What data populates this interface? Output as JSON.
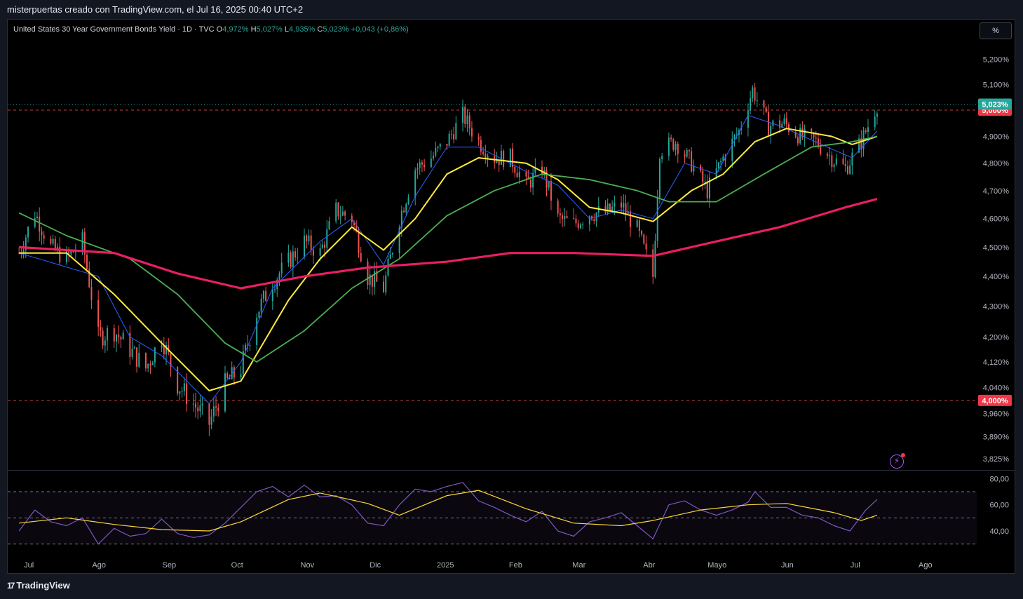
{
  "header": {
    "attribution": "misterpuertas creado con TradingView.com, el Jul 16, 2025 00:40 UTC+2"
  },
  "legend": {
    "symbol": "United States 30 Year Government Bonds Yield · 1D · TVC",
    "o_label": "O",
    "o_value": "4,972%",
    "h_label": "H",
    "h_value": "5,027%",
    "l_label": "L",
    "l_value": "4,935%",
    "c_label": "C",
    "c_value": "5,023%",
    "change": "+0,043 (+0,86%)"
  },
  "unit_button": "%",
  "footer": {
    "brand": "TradingView",
    "logo": "17"
  },
  "colors": {
    "up": "#26a69a",
    "down": "#ef5350",
    "ma_fast": "#2962ff",
    "ma_mid": "#ffeb3b",
    "ma_slow": "#4caf50",
    "ma_long": "#e91e63",
    "rsi": "#7e57c2",
    "rsi_ma": "#fdd835"
  },
  "chart_data": [
    {
      "type": "candlestick",
      "title": "United States 30 Year Government Bonds Yield · 1D · TVC",
      "y_ticks": [
        "5,200%",
        "5,100%",
        "4,900%",
        "4,800%",
        "4,700%",
        "4,600%",
        "4,500%",
        "4,400%",
        "4,300%",
        "4,200%",
        "4,120%",
        "4,040%",
        "3,960%",
        "3,890%",
        "3,825%"
      ],
      "y_scale": "log",
      "ylim": [
        3.8,
        5.26
      ],
      "x_ticks": [
        "Jul",
        "Ago",
        "Sep",
        "Oct",
        "Nov",
        "Dic",
        "2025",
        "Feb",
        "Mar",
        "Abr",
        "Mayo",
        "Jun",
        "Jul",
        "Ago"
      ],
      "last_price_label": "5,023%",
      "horizontal_lines": [
        {
          "value": 5.0,
          "label": "5,000%"
        },
        {
          "value": 4.0,
          "label": "4,000%"
        }
      ],
      "series": [
        {
          "name": "close",
          "x": [
            "Jul",
            "Ago",
            "Sep",
            "Oct",
            "Nov",
            "Dic",
            "2025",
            "Feb",
            "Mar",
            "Abr",
            "Mayo",
            "Jun",
            "Jul"
          ],
          "values": [
            4.47,
            4.42,
            4.1,
            4.06,
            4.58,
            4.4,
            4.94,
            4.78,
            4.64,
            4.55,
            4.85,
            4.92,
            5.02
          ]
        }
      ],
      "anchors": {
        "points": [
          [
            "2024-07-01",
            4.48
          ],
          [
            "2024-07-08",
            4.62
          ],
          [
            "2024-07-15",
            4.5
          ],
          [
            "2024-07-22",
            4.46
          ],
          [
            "2024-07-29",
            4.52
          ],
          [
            "2024-08-05",
            4.2
          ],
          [
            "2024-08-12",
            4.22
          ],
          [
            "2024-08-19",
            4.16
          ],
          [
            "2024-08-26",
            4.1
          ],
          [
            "2024-09-02",
            4.2
          ],
          [
            "2024-09-09",
            4.05
          ],
          [
            "2024-09-16",
            3.99
          ],
          [
            "2024-09-23",
            3.93
          ],
          [
            "2024-09-30",
            4.05
          ],
          [
            "2024-10-07",
            4.1
          ],
          [
            "2024-10-14",
            4.28
          ],
          [
            "2024-10-21",
            4.38
          ],
          [
            "2024-10-28",
            4.45
          ],
          [
            "2024-11-04",
            4.52
          ],
          [
            "2024-11-11",
            4.48
          ],
          [
            "2024-11-18",
            4.63
          ],
          [
            "2024-11-25",
            4.6
          ],
          [
            "2024-12-02",
            4.4
          ],
          [
            "2024-12-09",
            4.36
          ],
          [
            "2024-12-16",
            4.6
          ],
          [
            "2024-12-23",
            4.78
          ],
          [
            "2024-12-30",
            4.82
          ],
          [
            "2025-01-06",
            4.88
          ],
          [
            "2025-01-13",
            4.98
          ],
          [
            "2025-01-20",
            4.88
          ],
          [
            "2025-01-27",
            4.82
          ],
          [
            "2025-02-03",
            4.82
          ],
          [
            "2025-02-10",
            4.72
          ],
          [
            "2025-02-17",
            4.78
          ],
          [
            "2025-02-24",
            4.6
          ],
          [
            "2025-03-03",
            4.58
          ],
          [
            "2025-03-10",
            4.62
          ],
          [
            "2025-03-17",
            4.62
          ],
          [
            "2025-03-24",
            4.65
          ],
          [
            "2025-03-31",
            4.56
          ],
          [
            "2025-04-07",
            4.4
          ],
          [
            "2025-04-10",
            4.85
          ],
          [
            "2025-04-17",
            4.88
          ],
          [
            "2025-04-24",
            4.8
          ],
          [
            "2025-05-01",
            4.7
          ],
          [
            "2025-05-08",
            4.82
          ],
          [
            "2025-05-15",
            4.92
          ],
          [
            "2025-05-21",
            5.08
          ],
          [
            "2025-05-28",
            4.94
          ],
          [
            "2025-06-04",
            4.95
          ],
          [
            "2025-06-11",
            4.9
          ],
          [
            "2025-06-18",
            4.88
          ],
          [
            "2025-06-25",
            4.82
          ],
          [
            "2025-07-01",
            4.78
          ],
          [
            "2025-07-08",
            4.88
          ],
          [
            "2025-07-15",
            5.02
          ]
        ]
      },
      "moving_averages": [
        {
          "color": "ma_fast",
          "points": [
            [
              "2024-07-01",
              4.48
            ],
            [
              "2024-08-05",
              4.4
            ],
            [
              "2024-08-19",
              4.2
            ],
            [
              "2024-09-02",
              4.14
            ],
            [
              "2024-09-23",
              3.99
            ],
            [
              "2024-10-07",
              4.12
            ],
            [
              "2024-10-21",
              4.36
            ],
            [
              "2024-11-11",
              4.52
            ],
            [
              "2024-11-25",
              4.6
            ],
            [
              "2024-12-09",
              4.44
            ],
            [
              "2024-12-23",
              4.68
            ],
            [
              "2025-01-06",
              4.86
            ],
            [
              "2025-01-20",
              4.86
            ],
            [
              "2025-02-10",
              4.77
            ],
            [
              "2025-02-24",
              4.72
            ],
            [
              "2025-03-10",
              4.6
            ],
            [
              "2025-03-24",
              4.63
            ],
            [
              "2025-04-07",
              4.6
            ],
            [
              "2025-04-21",
              4.8
            ],
            [
              "2025-05-05",
              4.76
            ],
            [
              "2025-05-19",
              4.98
            ],
            [
              "2025-06-02",
              4.94
            ],
            [
              "2025-06-23",
              4.86
            ],
            [
              "2025-07-04",
              4.82
            ],
            [
              "2025-07-15",
              4.92
            ]
          ]
        },
        {
          "color": "ma_mid",
          "points": [
            [
              "2024-07-01",
              4.48
            ],
            [
              "2024-07-22",
              4.48
            ],
            [
              "2024-08-12",
              4.34
            ],
            [
              "2024-09-02",
              4.18
            ],
            [
              "2024-09-23",
              4.03
            ],
            [
              "2024-10-07",
              4.06
            ],
            [
              "2024-10-28",
              4.32
            ],
            [
              "2024-11-11",
              4.46
            ],
            [
              "2024-11-25",
              4.57
            ],
            [
              "2024-12-09",
              4.49
            ],
            [
              "2024-12-23",
              4.6
            ],
            [
              "2025-01-06",
              4.76
            ],
            [
              "2025-01-20",
              4.82
            ],
            [
              "2025-02-10",
              4.8
            ],
            [
              "2025-02-24",
              4.74
            ],
            [
              "2025-03-10",
              4.64
            ],
            [
              "2025-03-24",
              4.62
            ],
            [
              "2025-04-07",
              4.59
            ],
            [
              "2025-04-24",
              4.7
            ],
            [
              "2025-05-08",
              4.76
            ],
            [
              "2025-05-22",
              4.88
            ],
            [
              "2025-06-05",
              4.93
            ],
            [
              "2025-06-25",
              4.9
            ],
            [
              "2025-07-04",
              4.87
            ],
            [
              "2025-07-15",
              4.9
            ]
          ]
        },
        {
          "color": "ma_slow",
          "points": [
            [
              "2024-07-01",
              4.62
            ],
            [
              "2024-07-22",
              4.54
            ],
            [
              "2024-08-19",
              4.46
            ],
            [
              "2024-09-09",
              4.34
            ],
            [
              "2024-09-30",
              4.18
            ],
            [
              "2024-10-14",
              4.12
            ],
            [
              "2024-11-04",
              4.22
            ],
            [
              "2024-11-25",
              4.36
            ],
            [
              "2024-12-16",
              4.46
            ],
            [
              "2025-01-06",
              4.61
            ],
            [
              "2025-01-27",
              4.7
            ],
            [
              "2025-02-17",
              4.76
            ],
            [
              "2025-03-10",
              4.74
            ],
            [
              "2025-03-31",
              4.7
            ],
            [
              "2025-04-14",
              4.66
            ],
            [
              "2025-05-05",
              4.66
            ],
            [
              "2025-05-26",
              4.76
            ],
            [
              "2025-06-16",
              4.86
            ],
            [
              "2025-07-04",
              4.88
            ],
            [
              "2025-07-15",
              4.9
            ]
          ]
        },
        {
          "color": "ma_long",
          "points": [
            [
              "2024-07-01",
              4.5
            ],
            [
              "2024-08-12",
              4.48
            ],
            [
              "2024-09-09",
              4.41
            ],
            [
              "2024-10-07",
              4.36
            ],
            [
              "2024-11-04",
              4.4
            ],
            [
              "2024-12-02",
              4.43
            ],
            [
              "2025-01-06",
              4.45
            ],
            [
              "2025-02-03",
              4.48
            ],
            [
              "2025-03-03",
              4.48
            ],
            [
              "2025-04-07",
              4.47
            ],
            [
              "2025-05-05",
              4.52
            ],
            [
              "2025-06-02",
              4.57
            ],
            [
              "2025-07-01",
              4.64
            ],
            [
              "2025-07-15",
              4.67
            ]
          ]
        }
      ]
    },
    {
      "type": "line",
      "title": "",
      "y_ticks": [
        "80,00",
        "60,00",
        "40,00"
      ],
      "ylim": [
        25,
        85
      ],
      "bands": [
        70,
        50,
        30
      ],
      "series": [
        {
          "color": "rsi",
          "points": [
            [
              "2024-07-01",
              40
            ],
            [
              "2024-07-08",
              56
            ],
            [
              "2024-07-15",
              47
            ],
            [
              "2024-07-22",
              44
            ],
            [
              "2024-07-29",
              50
            ],
            [
              "2024-08-05",
              30
            ],
            [
              "2024-08-12",
              42
            ],
            [
              "2024-08-19",
              36
            ],
            [
              "2024-08-26",
              38
            ],
            [
              "2024-09-02",
              49
            ],
            [
              "2024-09-09",
              38
            ],
            [
              "2024-09-16",
              35
            ],
            [
              "2024-09-23",
              37
            ],
            [
              "2024-09-30",
              46
            ],
            [
              "2024-10-07",
              58
            ],
            [
              "2024-10-14",
              70
            ],
            [
              "2024-10-21",
              74
            ],
            [
              "2024-10-28",
              66
            ],
            [
              "2024-11-04",
              75
            ],
            [
              "2024-11-11",
              66
            ],
            [
              "2024-11-18",
              67
            ],
            [
              "2024-11-25",
              60
            ],
            [
              "2024-12-02",
              46
            ],
            [
              "2024-12-09",
              44
            ],
            [
              "2024-12-16",
              60
            ],
            [
              "2024-12-23",
              72
            ],
            [
              "2024-12-30",
              70
            ],
            [
              "2025-01-06",
              74
            ],
            [
              "2025-01-13",
              77
            ],
            [
              "2025-01-20",
              63
            ],
            [
              "2025-01-27",
              58
            ],
            [
              "2025-02-03",
              52
            ],
            [
              "2025-02-10",
              47
            ],
            [
              "2025-02-17",
              55
            ],
            [
              "2025-02-24",
              40
            ],
            [
              "2025-03-03",
              36
            ],
            [
              "2025-03-10",
              47
            ],
            [
              "2025-03-17",
              50
            ],
            [
              "2025-03-24",
              54
            ],
            [
              "2025-03-31",
              44
            ],
            [
              "2025-04-07",
              34
            ],
            [
              "2025-04-14",
              60
            ],
            [
              "2025-04-21",
              63
            ],
            [
              "2025-04-28",
              56
            ],
            [
              "2025-05-05",
              52
            ],
            [
              "2025-05-12",
              56
            ],
            [
              "2025-05-19",
              62
            ],
            [
              "2025-05-22",
              70
            ],
            [
              "2025-05-29",
              58
            ],
            [
              "2025-06-05",
              58
            ],
            [
              "2025-06-12",
              52
            ],
            [
              "2025-06-19",
              50
            ],
            [
              "2025-06-26",
              44
            ],
            [
              "2025-07-03",
              40
            ],
            [
              "2025-07-10",
              56
            ],
            [
              "2025-07-15",
              64
            ]
          ]
        },
        {
          "color": "rsi_ma",
          "points": [
            [
              "2024-07-01",
              46
            ],
            [
              "2024-07-22",
              50
            ],
            [
              "2024-08-12",
              45
            ],
            [
              "2024-09-02",
              41
            ],
            [
              "2024-09-23",
              40
            ],
            [
              "2024-10-07",
              47
            ],
            [
              "2024-10-28",
              64
            ],
            [
              "2024-11-11",
              69
            ],
            [
              "2024-12-02",
              61
            ],
            [
              "2024-12-16",
              52
            ],
            [
              "2025-01-06",
              67
            ],
            [
              "2025-01-20",
              71
            ],
            [
              "2025-02-10",
              57
            ],
            [
              "2025-03-03",
              46
            ],
            [
              "2025-03-24",
              44
            ],
            [
              "2025-04-07",
              48
            ],
            [
              "2025-04-28",
              56
            ],
            [
              "2025-05-19",
              60
            ],
            [
              "2025-06-05",
              61
            ],
            [
              "2025-06-26",
              54
            ],
            [
              "2025-07-08",
              48
            ],
            [
              "2025-07-15",
              52
            ]
          ]
        }
      ]
    }
  ]
}
